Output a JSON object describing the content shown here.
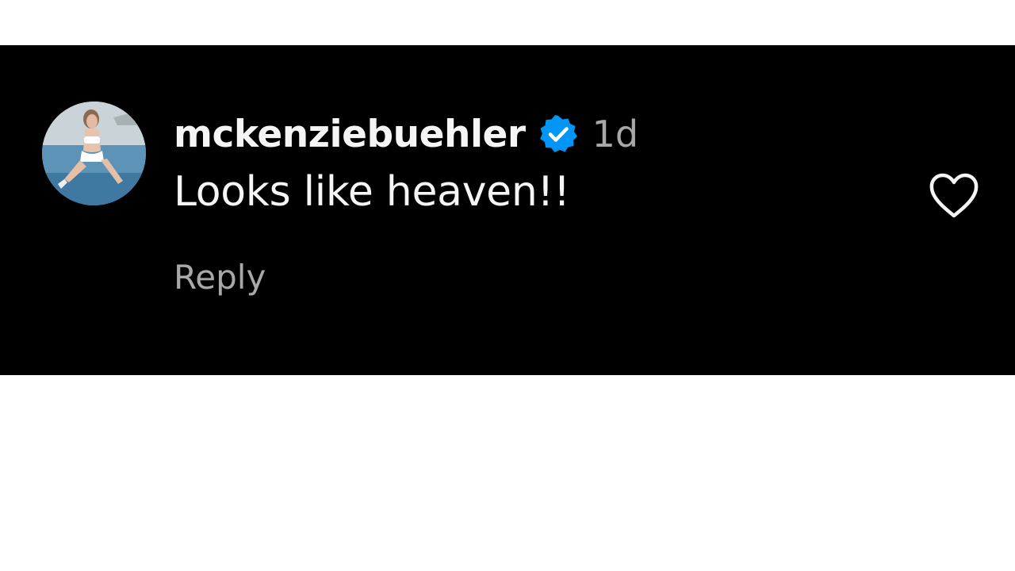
{
  "comment": {
    "username": "mckenziebuehler",
    "verified": true,
    "time": "1d",
    "text": "Looks like heaven!!",
    "reply_label": "Reply",
    "avatar_icon": "profile-photo",
    "like_icon": "heart-outline-icon"
  },
  "colors": {
    "card_background": "#000000",
    "page_background": "#ffffff",
    "primary_text": "#f5f5f5",
    "secondary_text": "#a8a8a8",
    "verified_badge": "#0095f6"
  }
}
